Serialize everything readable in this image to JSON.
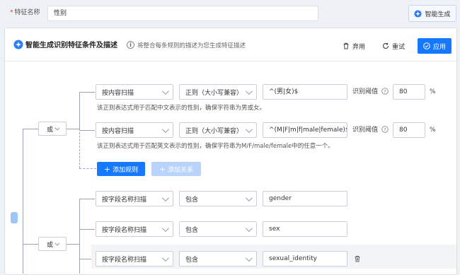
{
  "header": {
    "required_mark": "*",
    "field_label": "特征名称",
    "field_value": "性别",
    "generate_button": "智能生成"
  },
  "panel": {
    "title": "智能生成识别特征条件及描述",
    "info_icon": "i",
    "description": "将整合每条规则的描述为您生成特征描述",
    "discard_button": "弃用",
    "reset_button": "重试",
    "apply_button": "应用"
  },
  "group1": {
    "operator": "或",
    "rules": [
      {
        "scan_type": "按内容扫描",
        "match_type": "正则（大小写兼容）",
        "value": "^(男|女)$",
        "threshold_label": "识别阈值",
        "threshold": "80",
        "threshold_unit": "%",
        "description": "该正则表达式用于匹配中文表示的性别，确保字符串为男或女。"
      },
      {
        "scan_type": "按内容扫描",
        "match_type": "正则（大小写兼容）",
        "value": "^(M|F|m|f|male|female)$",
        "threshold_label": "识别阈值",
        "threshold": "80",
        "threshold_unit": "%",
        "description": "该正则表达式用于匹配英文表示的性别，确保字符串为M/F/male/female中的任意一个。"
      }
    ],
    "add_rule_button": "添加规则",
    "add_relation_button": "添加关系"
  },
  "group2": {
    "operator": "或",
    "rules": [
      {
        "scan_type": "按字段名称扫描",
        "match_type": "包含",
        "value": "gender"
      },
      {
        "scan_type": "按字段名称扫描",
        "match_type": "包含",
        "value": "sex"
      },
      {
        "scan_type": "按字段名称扫描",
        "match_type": "包含",
        "value": "sexual_identity"
      }
    ]
  },
  "colors": {
    "primary": "#1677ff",
    "primary_disabled": "#b9d4fa",
    "required": "#e4393c"
  }
}
